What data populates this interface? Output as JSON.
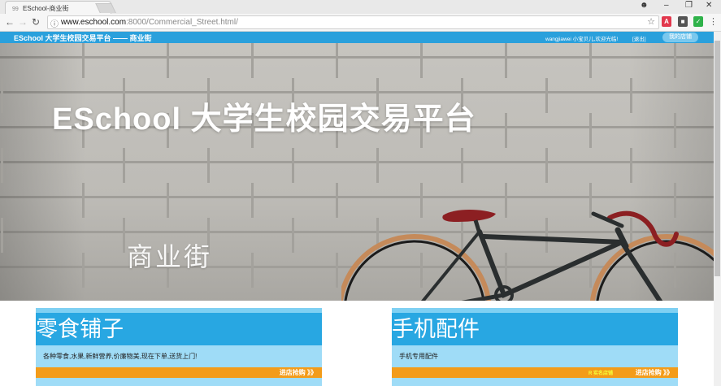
{
  "browser": {
    "tab_title": "ESchool-商业街",
    "tab_favicon": "99",
    "url_host": "www.eschool.com",
    "url_path": ":8000/Commercial_Street.html/"
  },
  "header": {
    "brand": "ESchool 大学生校园交易平台 —— 商业街",
    "welcome": "wangjiawei 小宝贝儿,欢迎光临!",
    "logout": "[退出]",
    "my_store": "我的店铺"
  },
  "hero": {
    "title": "ESchool 大学生校园交易平台",
    "subtitle": "商业街"
  },
  "cards": [
    {
      "name": "零食铺子",
      "description": "各种零食,水果,新鲜营养,价廉物美,现在下单,送货上门!",
      "verified": "",
      "cta": "进店抢购 》》"
    },
    {
      "name": "手机配件",
      "description": "手机专用配件",
      "verified": "R 实名店铺",
      "cta": "进店抢购 》》"
    }
  ],
  "colors": {
    "header_blue": "#2aa0dc",
    "card_blue": "#28a7e2",
    "card_light": "#9fdcf7",
    "accent_orange": "#f39c1a"
  }
}
